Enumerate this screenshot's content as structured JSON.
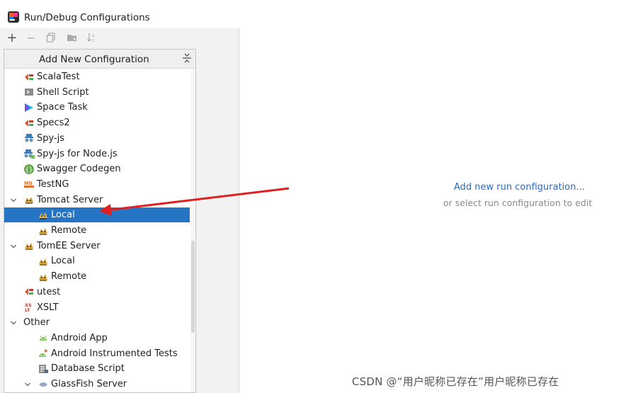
{
  "window": {
    "title": "Run/Debug Configurations"
  },
  "toolbar": {
    "add_icon": "plus-icon",
    "remove_icon": "minus-icon",
    "copy_icon": "copy-icon",
    "folder_icon": "move-to-folder-icon",
    "sort_icon": "sort-icon"
  },
  "popup": {
    "title": "Add New Configuration",
    "items": [
      {
        "label": "ScalaTest",
        "icon": "scalatest-icon"
      },
      {
        "label": "Shell Script",
        "icon": "shell-script-icon"
      },
      {
        "label": "Space Task",
        "icon": "space-task-icon"
      },
      {
        "label": "Specs2",
        "icon": "specs2-icon"
      },
      {
        "label": "Spy-js",
        "icon": "spy-js-icon"
      },
      {
        "label": "Spy-js for Node.js",
        "icon": "spy-js-node-icon"
      },
      {
        "label": "Swagger Codegen",
        "icon": "swagger-icon"
      },
      {
        "label": "TestNG",
        "icon": "testng-icon"
      },
      {
        "label": "Tomcat Server",
        "icon": "tomcat-icon",
        "expanded": true
      },
      {
        "label": "Local",
        "icon": "tomcat-icon",
        "selected": true
      },
      {
        "label": "Remote",
        "icon": "tomcat-icon"
      },
      {
        "label": "TomEE Server",
        "icon": "tomee-icon",
        "expanded": true
      },
      {
        "label": "Local",
        "icon": "tomee-icon"
      },
      {
        "label": "Remote",
        "icon": "tomee-icon"
      },
      {
        "label": "utest",
        "icon": "utest-icon"
      },
      {
        "label": "XSLT",
        "icon": "xslt-icon"
      },
      {
        "label": "Other",
        "expanded": true
      },
      {
        "label": "Android App",
        "icon": "android-icon"
      },
      {
        "label": "Android Instrumented Tests",
        "icon": "android-tests-icon"
      },
      {
        "label": "Database Script",
        "icon": "database-script-icon"
      },
      {
        "label": "GlassFish Server",
        "icon": "glassfish-icon"
      }
    ]
  },
  "main": {
    "link": "Add new run configuration...",
    "hint": "or select run configuration to edit"
  },
  "watermark": "CSDN @“用户昵称已存在”用户昵称已存在",
  "colors": {
    "selection": "#2675c5",
    "link": "#2a6cbf",
    "annotation_arrow": "#e02020"
  }
}
